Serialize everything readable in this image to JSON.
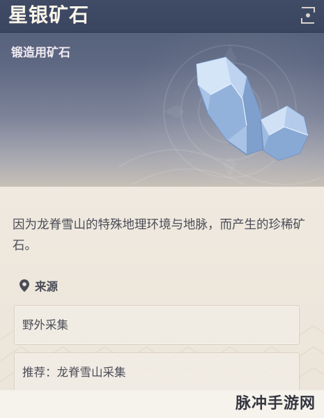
{
  "item": {
    "name": "星银矿石",
    "type": "锻造用矿石",
    "description": "因为龙脊雪山的特殊地理环境与地脉，而产生的珍稀矿石。",
    "icon": "silver-ore-icon"
  },
  "source": {
    "label": "来源",
    "icon": "location-pin-icon",
    "entries": [
      "野外采集",
      "推荐：龙脊雪山采集"
    ]
  },
  "watermark": "脉冲手游网",
  "colors": {
    "header_top": "#404b65",
    "header_bottom": "#c7c0b8",
    "body_bg": "#ece5da",
    "text": "#4b4c57",
    "title_text": "#fbf6ea"
  }
}
